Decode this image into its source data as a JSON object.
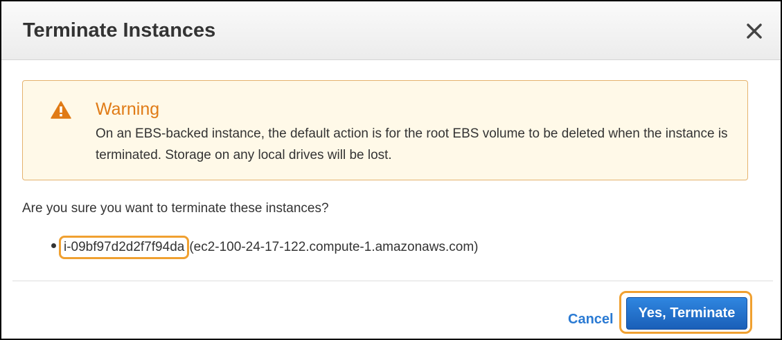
{
  "dialog": {
    "title": "Terminate Instances",
    "close_icon": "close-icon"
  },
  "warning": {
    "icon": "warning-icon",
    "title": "Warning",
    "message": "On an EBS-backed instance, the default action is for the root EBS volume to be deleted when the instance is terminated. Storage on any local drives will be lost.",
    "accent_color": "#e07b16",
    "background_color": "#fff9e8"
  },
  "confirmation": {
    "question": "Are you sure you want to terminate these instances?",
    "instances": [
      {
        "id": "i-09bf97d2d2f7f94da",
        "dns": "(ec2-100-24-17-122.compute-1.amazonaws.com)"
      }
    ]
  },
  "footer": {
    "cancel_label": "Cancel",
    "confirm_label": "Yes, Terminate",
    "confirm_color": "#1f6fc9",
    "highlight_color": "#f0a030"
  }
}
